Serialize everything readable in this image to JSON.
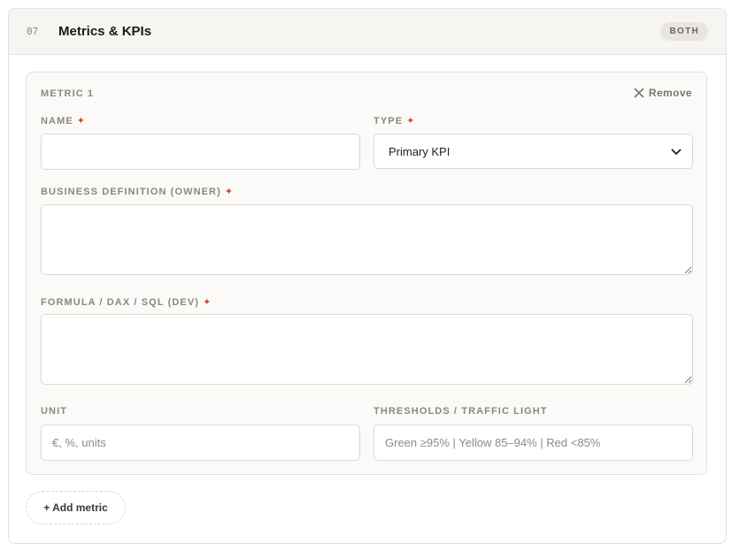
{
  "section": {
    "number": "07",
    "title": "Metrics & KPIs",
    "badge": "BOTH"
  },
  "metric": {
    "label": "METRIC 1",
    "remove_label": "Remove",
    "required_mark": "✦",
    "fields": {
      "name": {
        "label": "NAME",
        "value": "",
        "placeholder": ""
      },
      "type": {
        "label": "TYPE",
        "selected": "Primary KPI"
      },
      "business_definition": {
        "label": "BUSINESS DEFINITION (OWNER)",
        "value": ""
      },
      "formula": {
        "label": "FORMULA / DAX / SQL (DEV)",
        "value": ""
      },
      "unit": {
        "label": "UNIT",
        "placeholder": "€, %, units"
      },
      "thresholds": {
        "label": "THRESHOLDS / TRAFFIC LIGHT",
        "placeholder": "Green ≥95% | Yellow 85–94% | Red <85%"
      }
    }
  },
  "add_button_label": "+ Add metric",
  "colors": {
    "required": "#d6452b",
    "header_bg": "#f6f5f1",
    "card_bg": "#fbfaf8",
    "border": "#e3e1da",
    "muted_text": "#8b877c"
  },
  "icons": {
    "remove": "close-icon",
    "select": "chevron-down-icon"
  }
}
